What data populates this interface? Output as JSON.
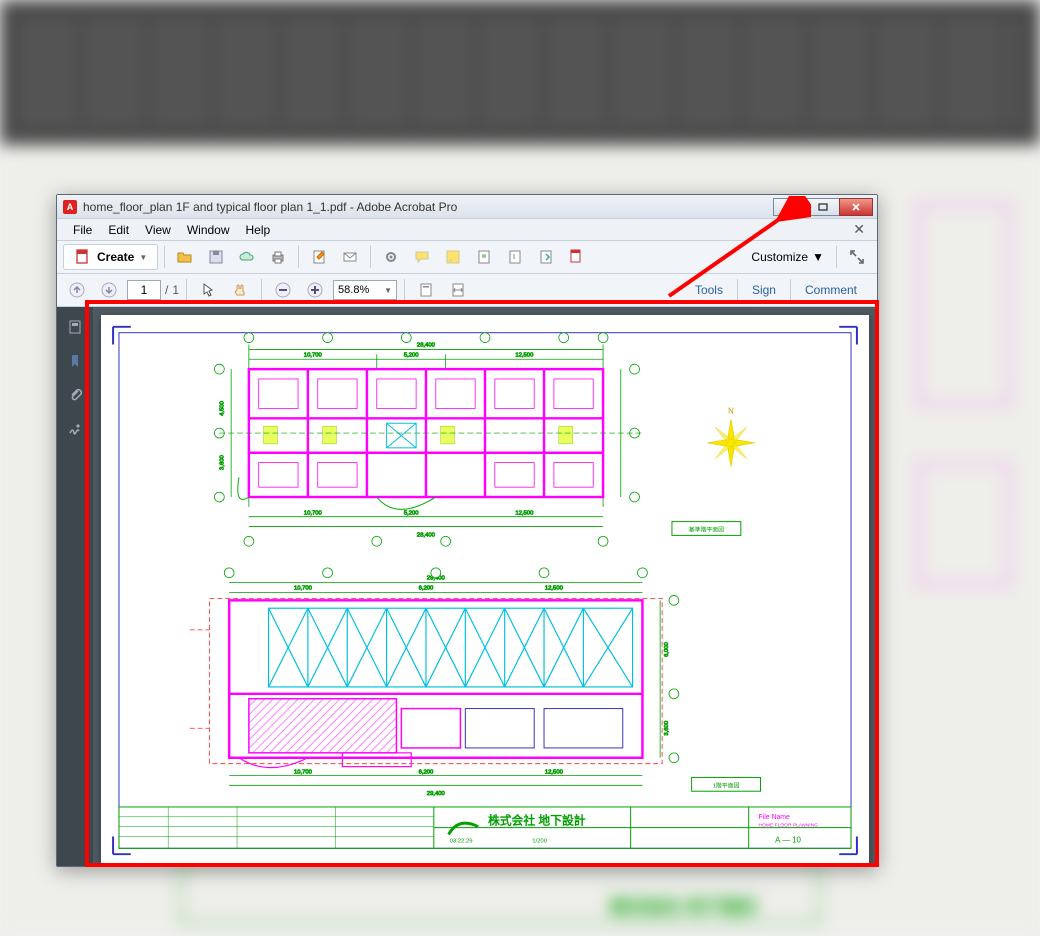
{
  "colors": {
    "magenta": "#ff00ff",
    "green": "#00a000",
    "cyan": "#00b0e0",
    "red": "#ff2020",
    "blue": "#3030c0",
    "accent_link": "#27639e"
  },
  "acrobat": {
    "title": "home_floor_plan 1F and typical floor plan 1_1.pdf - Adobe Acrobat Pro",
    "menus": [
      "File",
      "Edit",
      "View",
      "Window",
      "Help"
    ],
    "create_label": "Create",
    "customize_label": "Customize",
    "page_current": "1",
    "page_total": "1",
    "page_sep": "/",
    "zoom_value": "58.8%",
    "panes": [
      "Tools",
      "Sign",
      "Comment"
    ],
    "toolbar_icons": [
      "open",
      "save",
      "cloud",
      "print",
      "form",
      "mail",
      "gear",
      "comment",
      "highlight",
      "stamp",
      "attach",
      "link",
      "send"
    ],
    "nav_icons": [
      "thumbnails",
      "bookmarks",
      "attachments",
      "signatures"
    ],
    "toolbar2_icons_left": [
      "page-up",
      "page-down"
    ],
    "toolbar2_icons_mid": [
      "select",
      "pan"
    ],
    "toolbar2_icons_zoom": [
      "zoom-out",
      "zoom-in"
    ],
    "toolbar2_icons_right": [
      "fit1",
      "fit2"
    ]
  },
  "drawing": {
    "border_color": "#3030c0",
    "overall_dim_top": "28,400",
    "left_span_top": "10,700",
    "mid_span_top": "5,200",
    "right_span_top": "12,500",
    "left_span_bottom": "10,700",
    "mid_span_bottom": "5,200",
    "right_span_bottom": "12,500",
    "overall_dim_bottom": "28,400",
    "side_dim_a": "4,500",
    "side_dim_b": "3,600",
    "side_dim_c": "6,000",
    "section_overall": "29,400",
    "section_left": "10,700",
    "section_mid": "6,200",
    "section_right": "12,500",
    "north_label": "N",
    "titleblock_company": "株式会社 地下設計",
    "titleblock_file_label": "File Name",
    "titleblock_file": "HOME FLOOR PLANNING",
    "titleblock_sheet": "A — 10",
    "titleblock_scale": "1/200",
    "titleblock_date": "03.22.29",
    "legend_1": "基準階平面図",
    "legend_2": "1階平面図"
  }
}
